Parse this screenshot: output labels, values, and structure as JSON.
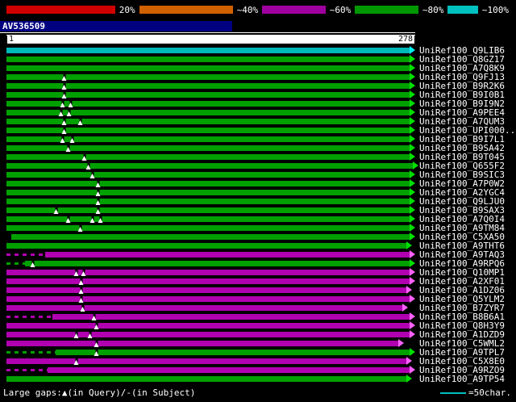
{
  "scale_bar": {
    "segments": [
      {
        "color": "#d00000",
        "label": "20%"
      },
      {
        "color": "#d06000",
        "label": "~40%"
      },
      {
        "color": "#a000a0",
        "label": "~60%"
      },
      {
        "color": "#009800",
        "label": "~80%"
      },
      {
        "color": "#00c0c0",
        "label": "~100%"
      }
    ]
  },
  "query": {
    "name": "AV536509",
    "ruler_start": "1",
    "ruler_end": "278"
  },
  "colors": {
    "background": "#000000",
    "tiers": {
      "cyan": {
        "bar": "#00b8b8",
        "arrow": "#00f0f0"
      },
      "green": {
        "bar": "#00a000",
        "arrow": "#00e000"
      },
      "magenta": {
        "bar": "#b000b0",
        "arrow": "#ff60ff"
      }
    }
  },
  "hits": [
    {
      "label": "UniRef100_Q9LIB6",
      "tier": "cyan",
      "start": 0,
      "end": 98.6,
      "markers": []
    },
    {
      "label": "UniRef100_Q8GZ17",
      "tier": "green",
      "start": 0,
      "end": 98.6,
      "markers": []
    },
    {
      "label": "UniRef100_A7Q8K9",
      "tier": "green",
      "start": 0,
      "end": 98.6,
      "markers": []
    },
    {
      "label": "UniRef100_Q9FJ13",
      "tier": "green",
      "start": 0,
      "end": 98.6,
      "markers": [
        14.2
      ]
    },
    {
      "label": "UniRef100_B9R2K6",
      "tier": "green",
      "start": 0,
      "end": 98.6,
      "markers": [
        14.2
      ]
    },
    {
      "label": "UniRef100_B9I0B1",
      "tier": "green",
      "start": 0,
      "end": 98.6,
      "markers": [
        14.2
      ]
    },
    {
      "label": "UniRef100_B9I9N2",
      "tier": "green",
      "start": 0,
      "end": 98.6,
      "markers": [
        13.8,
        15.8
      ]
    },
    {
      "label": "UniRef100_A9PEE4",
      "tier": "green",
      "start": 0,
      "end": 98.6,
      "markers": [
        13.4,
        15.4
      ]
    },
    {
      "label": "UniRef100_A7QUM3",
      "tier": "green",
      "start": 0,
      "end": 98.6,
      "markers": [
        14.2,
        18.1
      ]
    },
    {
      "label": "UniRef100_UPI000..",
      "tier": "green",
      "start": 0,
      "end": 98.6,
      "markers": [
        14.2
      ]
    },
    {
      "label": "UniRef100_B9I7L1",
      "tier": "green",
      "start": 0,
      "end": 98.6,
      "markers": [
        13.8,
        16.2
      ]
    },
    {
      "label": "UniRef100_B9SA42",
      "tier": "green",
      "start": 0,
      "end": 98.6,
      "markers": [
        15.2
      ]
    },
    {
      "label": "UniRef100_B9T045",
      "tier": "green",
      "start": 0,
      "end": 98.6,
      "markers": [
        19.1
      ]
    },
    {
      "label": "UniRef100_Q655F2",
      "tier": "green",
      "start": 0,
      "end": 99.4,
      "markers": [
        20.1
      ]
    },
    {
      "label": "UniRef100_B9SIC3",
      "tier": "green",
      "start": 0,
      "end": 98.6,
      "markers": [
        21.1
      ]
    },
    {
      "label": "UniRef100_A7P0W2",
      "tier": "green",
      "start": 0,
      "end": 98.6,
      "markers": [
        22.5
      ]
    },
    {
      "label": "UniRef100_A2YGC4",
      "tier": "green",
      "start": 0,
      "end": 98.6,
      "markers": [
        22.5
      ]
    },
    {
      "label": "UniRef100_Q9LJU0",
      "tier": "green",
      "start": 0,
      "end": 98.6,
      "markers": [
        22.5
      ]
    },
    {
      "label": "UniRef100_B9SAX3",
      "tier": "green",
      "start": 0,
      "end": 98.6,
      "markers": [
        12.2,
        22.5
      ]
    },
    {
      "label": "UniRef100_A7Q0I4",
      "tier": "green",
      "start": 0,
      "end": 98.6,
      "markers": [
        15.2,
        21.1,
        23.1
      ]
    },
    {
      "label": "UniRef100_A9TM84",
      "tier": "green",
      "start": 0,
      "end": 98.6,
      "markers": [
        18.1
      ]
    },
    {
      "label": "UniRef100_C5XA50",
      "tier": "green",
      "start": 1.2,
      "end": 98.6,
      "markers": []
    },
    {
      "label": "UniRef100_A9THT6",
      "tier": "green",
      "start": 0,
      "end": 97.8,
      "markers": []
    },
    {
      "label": "UniRef100_A9TAQ3",
      "tier": "magenta",
      "start": 9.5,
      "end": 98.6,
      "markers": [],
      "lead": [
        0,
        9.5
      ]
    },
    {
      "label": "UniRef100_A9RPQ6",
      "tier": "green",
      "start": 4.5,
      "end": 98.6,
      "markers": [
        6.5
      ],
      "lead": [
        0,
        4.5
      ]
    },
    {
      "label": "UniRef100_Q10MP1",
      "tier": "magenta",
      "start": 0,
      "end": 98.6,
      "markers": [
        17.2,
        18.9
      ]
    },
    {
      "label": "UniRef100_A2XF01",
      "tier": "magenta",
      "start": 0,
      "end": 98.6,
      "markers": [
        18.3
      ]
    },
    {
      "label": "UniRef100_A1DZ06",
      "tier": "magenta",
      "start": 0,
      "end": 97.8,
      "markers": [
        18.3
      ]
    },
    {
      "label": "UniRef100_Q5YLM2",
      "tier": "magenta",
      "start": 0,
      "end": 98.6,
      "markers": [
        18.3
      ]
    },
    {
      "label": "UniRef100_B7ZYR7",
      "tier": "magenta",
      "start": 0,
      "end": 96.8,
      "markers": [
        18.7
      ]
    },
    {
      "label": "UniRef100_B8B6A1",
      "tier": "magenta",
      "start": 11.2,
      "end": 98.6,
      "markers": [
        21.5
      ],
      "lead": [
        0,
        11.2
      ]
    },
    {
      "label": "UniRef100_Q8H3Y9",
      "tier": "magenta",
      "start": 0,
      "end": 98.6,
      "markers": [
        22.1
      ]
    },
    {
      "label": "UniRef100_A1DZD9",
      "tier": "magenta",
      "start": 0,
      "end": 98.6,
      "markers": [
        17.2,
        20.5
      ]
    },
    {
      "label": "UniRef100_C5WML2",
      "tier": "magenta",
      "start": 0,
      "end": 95.8,
      "markers": [
        22.1
      ]
    },
    {
      "label": "UniRef100_A9TPL7",
      "tier": "green",
      "start": 12,
      "end": 98.6,
      "markers": [
        22.1
      ],
      "lead": [
        0,
        12
      ]
    },
    {
      "label": "UniRef100_C5X8E0",
      "tier": "magenta",
      "start": 0,
      "end": 97.8,
      "markers": [
        17.2
      ]
    },
    {
      "label": "UniRef100_A9RZO9",
      "tier": "magenta",
      "start": 10,
      "end": 98.6,
      "markers": [],
      "lead": [
        0,
        10
      ]
    },
    {
      "label": "UniRef100_A9TP54",
      "tier": "green",
      "start": 0,
      "end": 97.8,
      "markers": []
    }
  ],
  "footer": {
    "gaps_legend": "Large gaps:▲(in Query)/-(in Subject)",
    "scale_text": "=50char.",
    "scale_line_color": "#00c0c0"
  }
}
